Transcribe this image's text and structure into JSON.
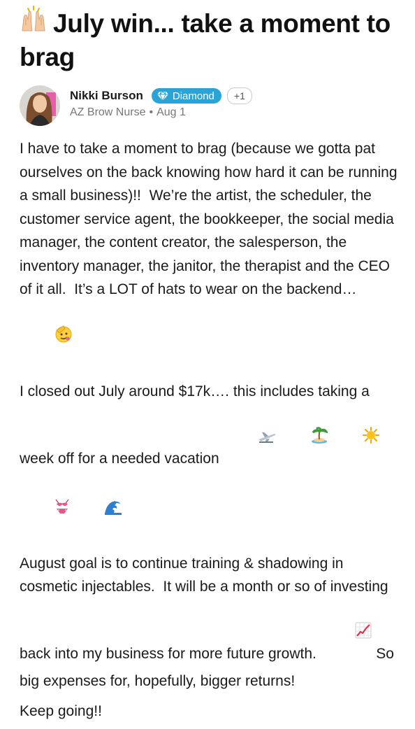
{
  "post": {
    "title_emoji": "raised-hands-icon",
    "title": "July win... take a moment to brag",
    "author": {
      "name": "Nikki Burson",
      "badge_label": "Diamond",
      "badge_icon": "diamond-icon",
      "badge_color": "#2aa3d6",
      "extra_badges": "+1",
      "business": "AZ Brow Nurse",
      "separator": "•",
      "date": "Aug 1"
    },
    "paragraphs": [
      {
        "text": "I have to take a moment to brag (because we gotta pat ourselves on the back knowing how hard it can be running a small business)!!  We’re the artist, the scheduler, the customer service agent, the bookkeeper, the social media manager, the content creator, the salesperson, the inventory manager, the janitor, the therapist and the CEO of it all.  It’s a LOT of hats to wear on the backend…",
        "trailing_emoji": [
          "saluting-face-icon"
        ]
      },
      {
        "text": "I closed out July around $17k…. this includes taking a week off for a needed vacation",
        "trailing_emoji": [
          "airplane-icon",
          "palm-island-icon",
          "sun-icon",
          "bikini-icon",
          "wave-icon"
        ]
      },
      {
        "text": "August goal is to continue training & shadowing in cosmetic injectables.  It will be a month or so of investing back into my business for more future growth.",
        "inline_emoji": "chart-increasing-icon",
        "text_after_emoji": "So big expenses for, hopefully, bigger returns!"
      },
      {
        "text": "Keep going!!"
      }
    ]
  }
}
